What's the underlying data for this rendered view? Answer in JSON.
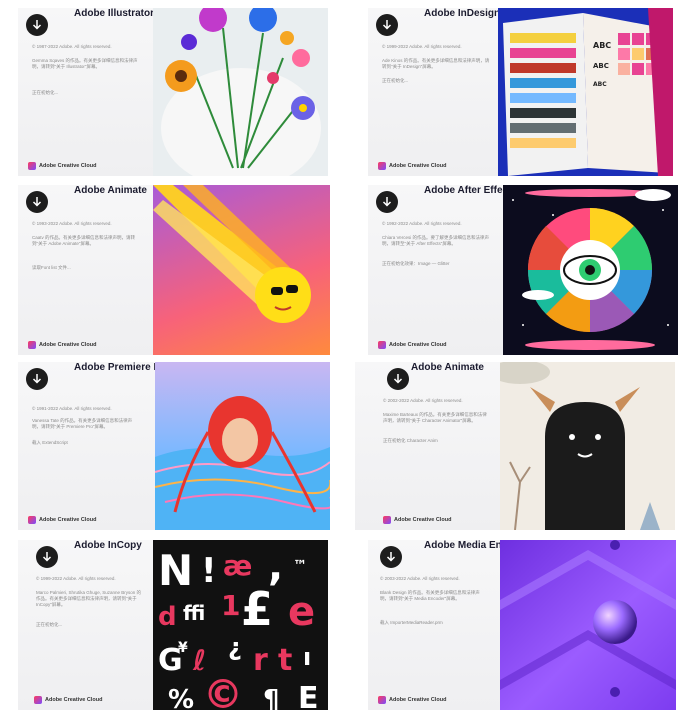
{
  "cards": [
    {
      "title": "Adobe Illustrator",
      "copyright": "© 1987-2022 Adobe. All rights reserved.",
      "body": "Gemma Sqaves 的作品。有关更多详细信息和法律声明，请转到\"关于 Illustrator\"屏幕。",
      "link": "正在初始化...",
      "brand": "Adobe Creative Cloud"
    },
    {
      "title": "Adobe InDesign",
      "copyright": "© 1999-2022 Adobe. All rights reserved.",
      "body": "Ade Kinos 的作品。有关更多详细信息和法律声明，请转到\"关于 InDesign\"屏幕。",
      "link": "正在初始化...",
      "brand": "Adobe Creative Cloud"
    },
    {
      "title": "Adobe Animate",
      "copyright": "© 1993-2022 Adobe. All rights reserved.",
      "body": "Caatv 的作品。有关更多详细信息和法律声明，请转到\"关于 Adobe Animate\"屏幕。",
      "link": "读取Font list 文件...",
      "brand": "Adobe Creative Cloud"
    },
    {
      "title": "Adobe After Effects",
      "copyright": "© 1992-2022 Adobe. All rights reserved.",
      "body": "Chiara Vercesi 的作品。要了解更多详细信息和法律声明，请转至\"关于 After Effects\"屏幕。",
      "link": "正在初始化效果：Image — Glitter",
      "brand": "Adobe Creative Cloud"
    },
    {
      "title": "Adobe Premiere Pro",
      "copyright": "© 1991-2022 Adobe. All rights reserved.",
      "body": "Vanessa Tate 的作品。有关更多详细信息和法律声明，请转到\"关于 Premiere Pro\"屏幕。",
      "link": "载入 ExtendScript",
      "brand": "Adobe Creative Cloud"
    },
    {
      "title": "Adobe Animate",
      "copyright": "© 2002-2022 Adobe. All rights reserved.",
      "body": "Maxime Barteaux 的作品。有关更多详细信息和法律声明，请转到\"关于 Character Animator\"屏幕。",
      "link": "正在初始化 Character Anim",
      "brand": "Adobe Creative Cloud"
    },
    {
      "title": "Adobe InCopy",
      "copyright": "© 1999-2022 Adobe. All rights reserved.",
      "body": "Marco Palmieri, Shrutika Ghuge, Suzanne Bryson 的作品。有关更多详细信息和法律声明，请转到\"关于 InCopy\"屏幕。",
      "link": "正在初始化...",
      "brand": "Adobe Creative Cloud"
    },
    {
      "title": "Adobe Media Encoder",
      "copyright": "© 2003-2022 Adobe. All rights reserved.",
      "body": "Blank Design 的作品。有关更多详细信息和法律声明，请转到\"关于 Media Encoder\"屏幕。",
      "link": "载入 ImporterMediaReader.prm",
      "brand": "Adobe Creative Cloud"
    }
  ]
}
